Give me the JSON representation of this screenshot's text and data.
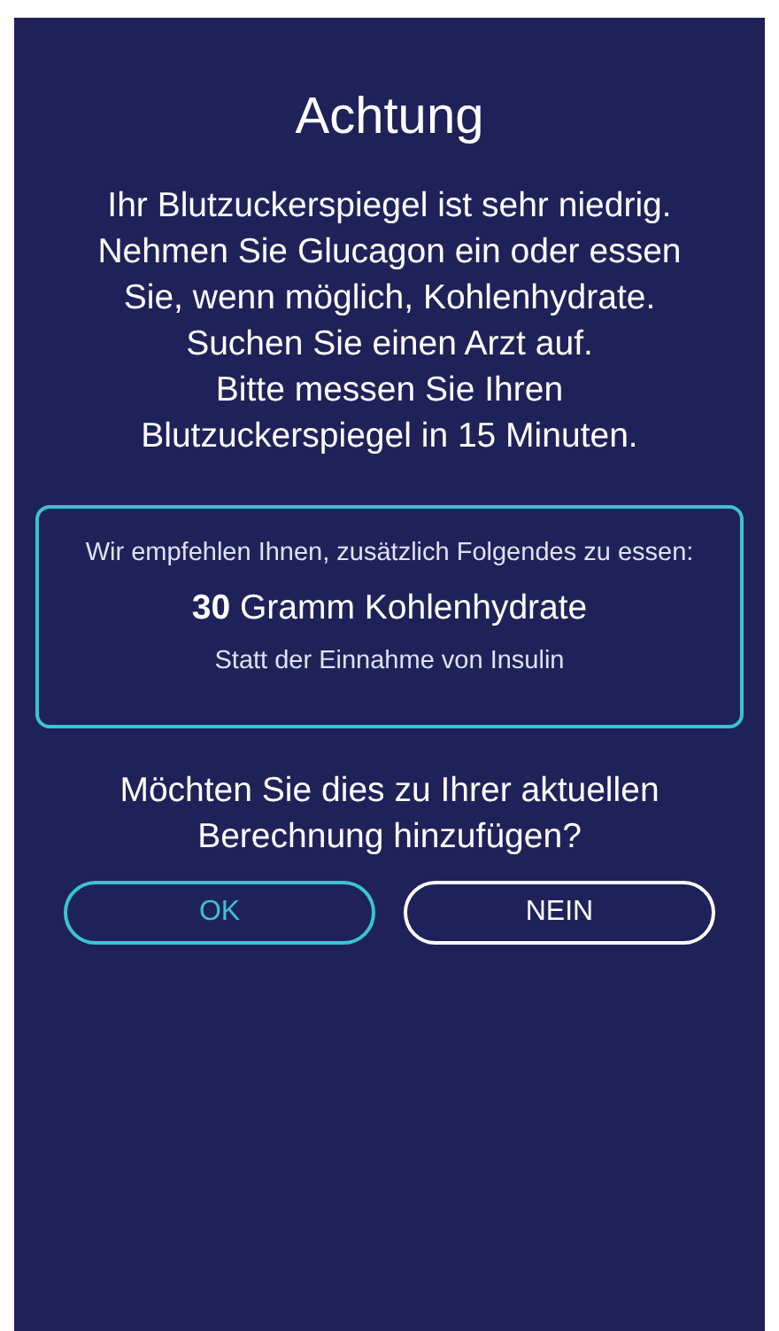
{
  "dialog": {
    "title": "Achtung",
    "message_lines": [
      "Ihr Blutzuckerspiegel ist sehr niedrig.",
      "Nehmen Sie Glucagon ein oder essen",
      "Sie, wenn möglich, Kohlenhydrate.",
      "Suchen Sie einen Arzt auf.",
      "Bitte messen Sie Ihren",
      "Blutzuckerspiegel in 15 Minuten."
    ],
    "recommendation": {
      "intro": "Wir empfehlen Ihnen, zusätzlich Folgendes zu essen:",
      "amount": "**30** Gramm Kohlenhydrate",
      "note": "Statt der Einnahme von Insulin"
    },
    "question": "Möchten Sie dies zu Ihrer aktuellen Berechnung hinzufügen?",
    "buttons": [
      {
        "label": "OK",
        "kind": "primary"
      },
      {
        "label": "NEIN",
        "kind": "secondary"
      }
    ]
  }
}
